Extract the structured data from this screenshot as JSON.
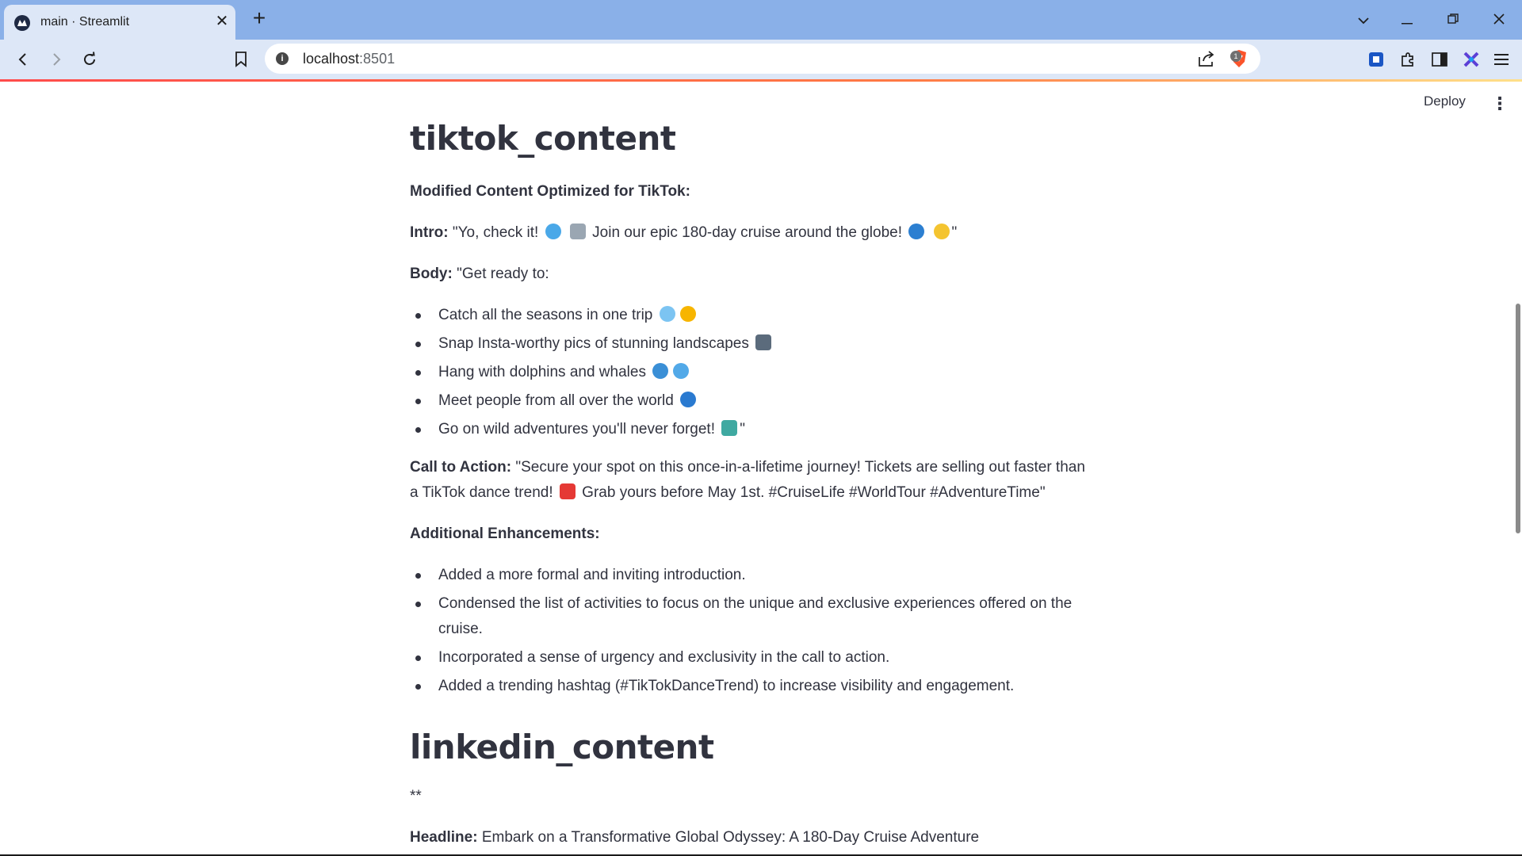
{
  "browser": {
    "tab_title": "main · Streamlit",
    "url_host": "localhost",
    "url_port": ":8501",
    "brave_badge": "1"
  },
  "header": {
    "deploy_label": "Deploy",
    "menu_icon": "kebab-menu-icon"
  },
  "tiktok": {
    "title": "tiktok_content",
    "subtitle": "Modified Content Optimized for TikTok:",
    "intro_label": "Intro:",
    "intro_a": "\"Yo, check it!",
    "intro_b": "Join our epic 180-day cruise around the globe!",
    "intro_c": "\"",
    "body_label": "Body:",
    "body_text": "\"Get ready to:",
    "bullets": [
      "Catch all the seasons in one trip",
      "Snap Insta-worthy pics of stunning landscapes",
      "Hang with dolphins and whales",
      "Meet people from all over the world",
      "Go on wild adventures you'll never forget!"
    ],
    "bullet_tail": "\"",
    "cta_label": "Call to Action:",
    "cta_a": "\"Secure your spot on this once-in-a-lifetime journey! Tickets are selling out faster than a TikTok dance trend!",
    "cta_b": "Grab yours before May 1st. #CruiseLife #WorldTour #AdventureTime\"",
    "enh_label": "Additional Enhancements:",
    "enhancements": [
      "Added a more formal and inviting introduction.",
      "Condensed the list of activities to focus on the unique and exclusive experiences offered on the cruise.",
      "Incorporated a sense of urgency and exclusivity in the call to action.",
      "Added a trending hashtag (#TikTokDanceTrend) to increase visibility and engagement."
    ]
  },
  "linkedin": {
    "title": "linkedin_content",
    "stars": "**",
    "headline_label": "Headline:",
    "headline_text": "Embark on a Transformative Global Odyssey: A 180-Day Cruise Adventure"
  },
  "emoji": {
    "wave": "wave-emoji",
    "ship": "ship-emoji",
    "globe": "globe-emoji",
    "sparkles": "sparkles-emoji",
    "snowflake": "snowflake-emoji",
    "sun": "sun-emoji",
    "camera": "camera-emoji",
    "dolphin": "dolphin-emoji",
    "whale": "whale-emoji",
    "map": "map-emoji",
    "ticket": "ticket-emoji"
  }
}
